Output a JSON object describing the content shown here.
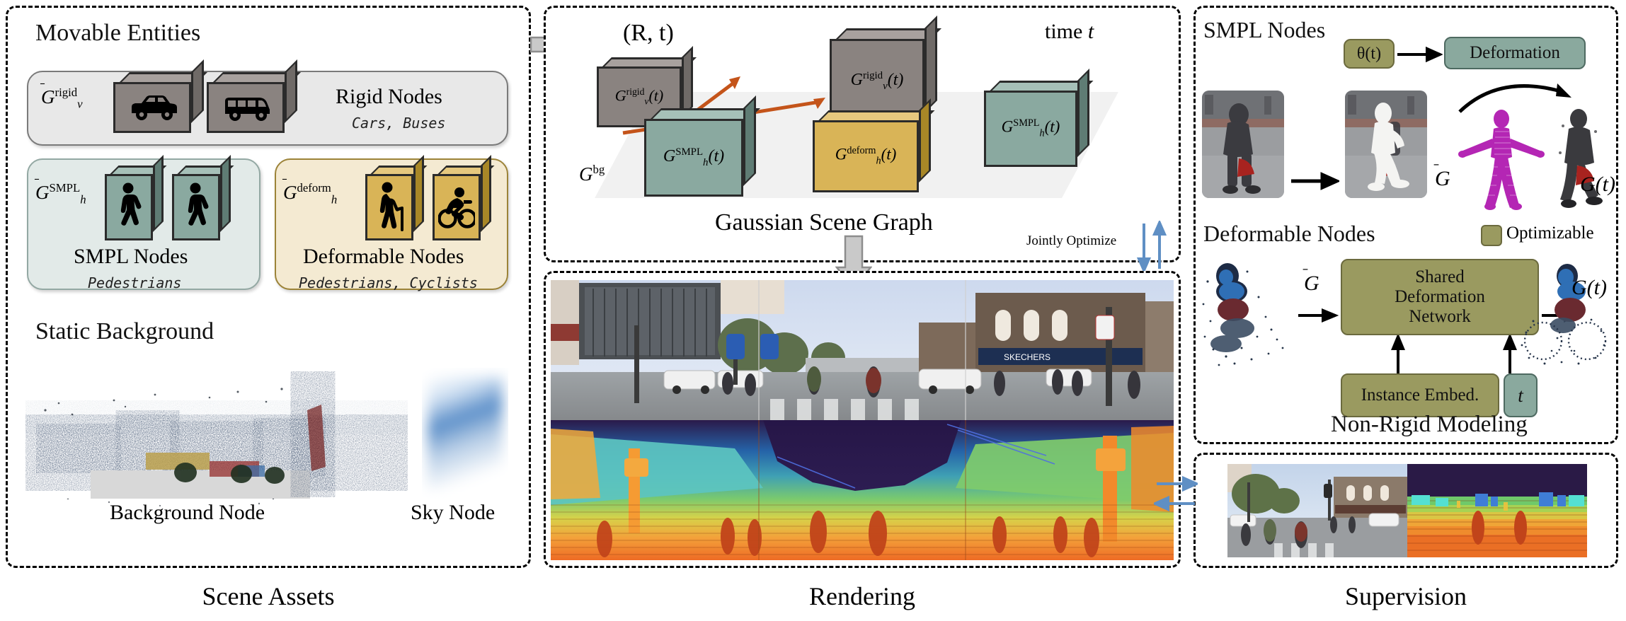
{
  "figure": {
    "title": "Gaussian Scene Graph driving scene reconstruction pipeline"
  },
  "panels": {
    "scene_assets": {
      "caption": "Scene Assets",
      "movable_title": "Movable Entities",
      "static_title": "Static Background",
      "rigid": {
        "symbol_base": "G",
        "symbol_sup": "rigid",
        "symbol_sub": "v",
        "label": "Rigid Nodes",
        "examples": "Cars, Buses",
        "cube_glyphs": [
          "car-icon",
          "bus-icon"
        ],
        "color": "#8a8380"
      },
      "smpl": {
        "symbol_base": "G",
        "symbol_sup": "SMPL",
        "symbol_sub": "h",
        "label": "SMPL Nodes",
        "examples": "Pedestrians",
        "cube_glyphs": [
          "pedestrian-icon",
          "pedestrian-icon"
        ],
        "color": "#8aa9a0"
      },
      "deform": {
        "symbol_base": "G",
        "symbol_sup": "deform",
        "symbol_sub": "h",
        "label": "Deformable Nodes",
        "examples": "Pedestrians, Cyclists",
        "cube_glyphs": [
          "walking-cane-icon",
          "cyclist-icon"
        ],
        "color": "#d9b457"
      },
      "background_node_label": "Background Node",
      "sky_node_label": "Sky Node"
    },
    "rendering": {
      "caption": "Rendering",
      "graph_title": "Gaussian Scene Graph",
      "time_label": "time",
      "time_var": "t",
      "transform_label": "(R, t)",
      "bg_symbol_base": "G",
      "bg_symbol_sup": "bg",
      "jointly_optimize_label": "Jointly Optimize",
      "graph_nodes": [
        {
          "base": "G",
          "sup": "rigid",
          "sub": "v",
          "arg": "(t)",
          "kind": "rigid"
        },
        {
          "base": "G",
          "sup": "SMPL",
          "sub": "h",
          "arg": "(t)",
          "kind": "smpl"
        },
        {
          "base": "G",
          "sup": "rigid",
          "sub": "v",
          "arg": "(t)",
          "kind": "rigid"
        },
        {
          "base": "G",
          "sup": "deform",
          "sub": "h",
          "arg": "(t)",
          "kind": "deform"
        },
        {
          "base": "G",
          "sup": "SMPL",
          "sub": "h",
          "arg": "(t)",
          "kind": "smpl"
        }
      ],
      "render_rgb_alt": "rendered rgb street view panorama",
      "render_depth_alt": "rendered depth map panorama"
    },
    "supervision": {
      "caption": "Supervision",
      "smpl_nodes_title": "SMPL Nodes",
      "deformable_nodes_title": "Deformable Nodes",
      "non_rigid_title": "Non-Rigid Modeling",
      "theta_label": "θ(t)",
      "deformation_label": "Deformation",
      "optimizable_label": "Optimizable",
      "optimizable_color": "#9a9a60",
      "shared_network_label": "Shared\nDeformation\nNetwork",
      "shared_network_lines": [
        "Shared",
        "Deformation",
        "Network"
      ],
      "instance_embed_label": "Instance Embed.",
      "time_token_label": "t",
      "canonical_symbol": "Ḡ",
      "dynamic_symbol": "G(t)",
      "gt_image_alt": "ground-truth street camera image",
      "lidar_image_alt": "lidar depth supervision image"
    }
  }
}
